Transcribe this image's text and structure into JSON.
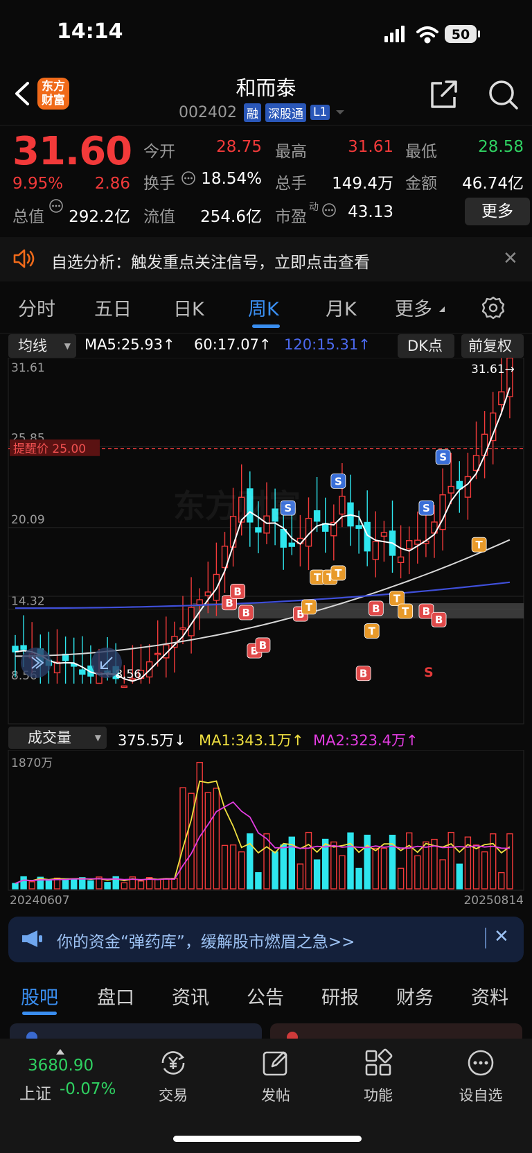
{
  "status": {
    "time": "14:14",
    "battery": "50"
  },
  "header": {
    "logo_line1": "东方",
    "logo_line2": "财富",
    "name": "和而泰",
    "code": "002402",
    "badges": [
      "融",
      "深股通",
      "L1"
    ]
  },
  "quote": {
    "price": "31.60",
    "pct": "9.95%",
    "change": "2.86",
    "open_label": "今开",
    "open": "28.75",
    "high_label": "最高",
    "high": "31.61",
    "low_label": "最低",
    "low": "28.58",
    "turnover_label": "换手",
    "turnover": "18.54%",
    "volume_label": "总手",
    "volume": "149.4万",
    "amount_label": "金额",
    "amount": "46.74亿",
    "mcap_label": "总值",
    "mcap": "292.2亿",
    "float_label": "流值",
    "float_cap": "254.6亿",
    "pe_label": "市盈",
    "pe_sup": "动",
    "pe": "43.13",
    "more": "更多"
  },
  "alert": {
    "text": "自选分析：触发重点关注信号，立即点击查看"
  },
  "period_tabs": [
    "分时",
    "五日",
    "日K",
    "周K",
    "月K",
    "更多"
  ],
  "indicators": {
    "ma_select": "均线",
    "ma5": "MA5:25.93↑",
    "ma60": "60:17.07↑",
    "ma120": "120:15.31↑",
    "dk": "DK点",
    "adjust": "前复权",
    "vol_select": "成交量",
    "vol": "375.5万↓",
    "vma1": "MA1:343.1万↑",
    "vma2": "MA2:323.4万↑"
  },
  "chart_data": {
    "type": "candlestick",
    "y_labels": [
      "31.61",
      "25.85",
      "20.09",
      "14.32",
      "8.56"
    ],
    "ylim": [
      8.56,
      31.61
    ],
    "high_label": "31.61→",
    "low_label": "←8.56",
    "alert_line": {
      "label": "提醒价 25.00",
      "value": 25.0
    },
    "signals": [
      "S",
      "B",
      "T"
    ],
    "vol_max_label": "1870万",
    "x_start": "20240607",
    "x_end": "20250814",
    "colors": {
      "up": "#f23a3a",
      "down": "#2ee6ee",
      "ma5": "#ffffff",
      "ma60": "#d8d8d8",
      "ma120": "#3f4fd9",
      "vma1": "#f0e040",
      "vma2": "#e23ce0"
    }
  },
  "promo": {
    "text": "你的资金“弹药库”，缓解股市燃眉之急>>"
  },
  "bottom_tabs": [
    "股吧",
    "盘口",
    "资讯",
    "公告",
    "研报",
    "财务",
    "资料"
  ],
  "dock": {
    "index_value": "3680.90",
    "index_name": "上证",
    "index_pct": "-0.07%",
    "items": [
      "交易",
      "发帖",
      "功能",
      "设自选"
    ]
  }
}
